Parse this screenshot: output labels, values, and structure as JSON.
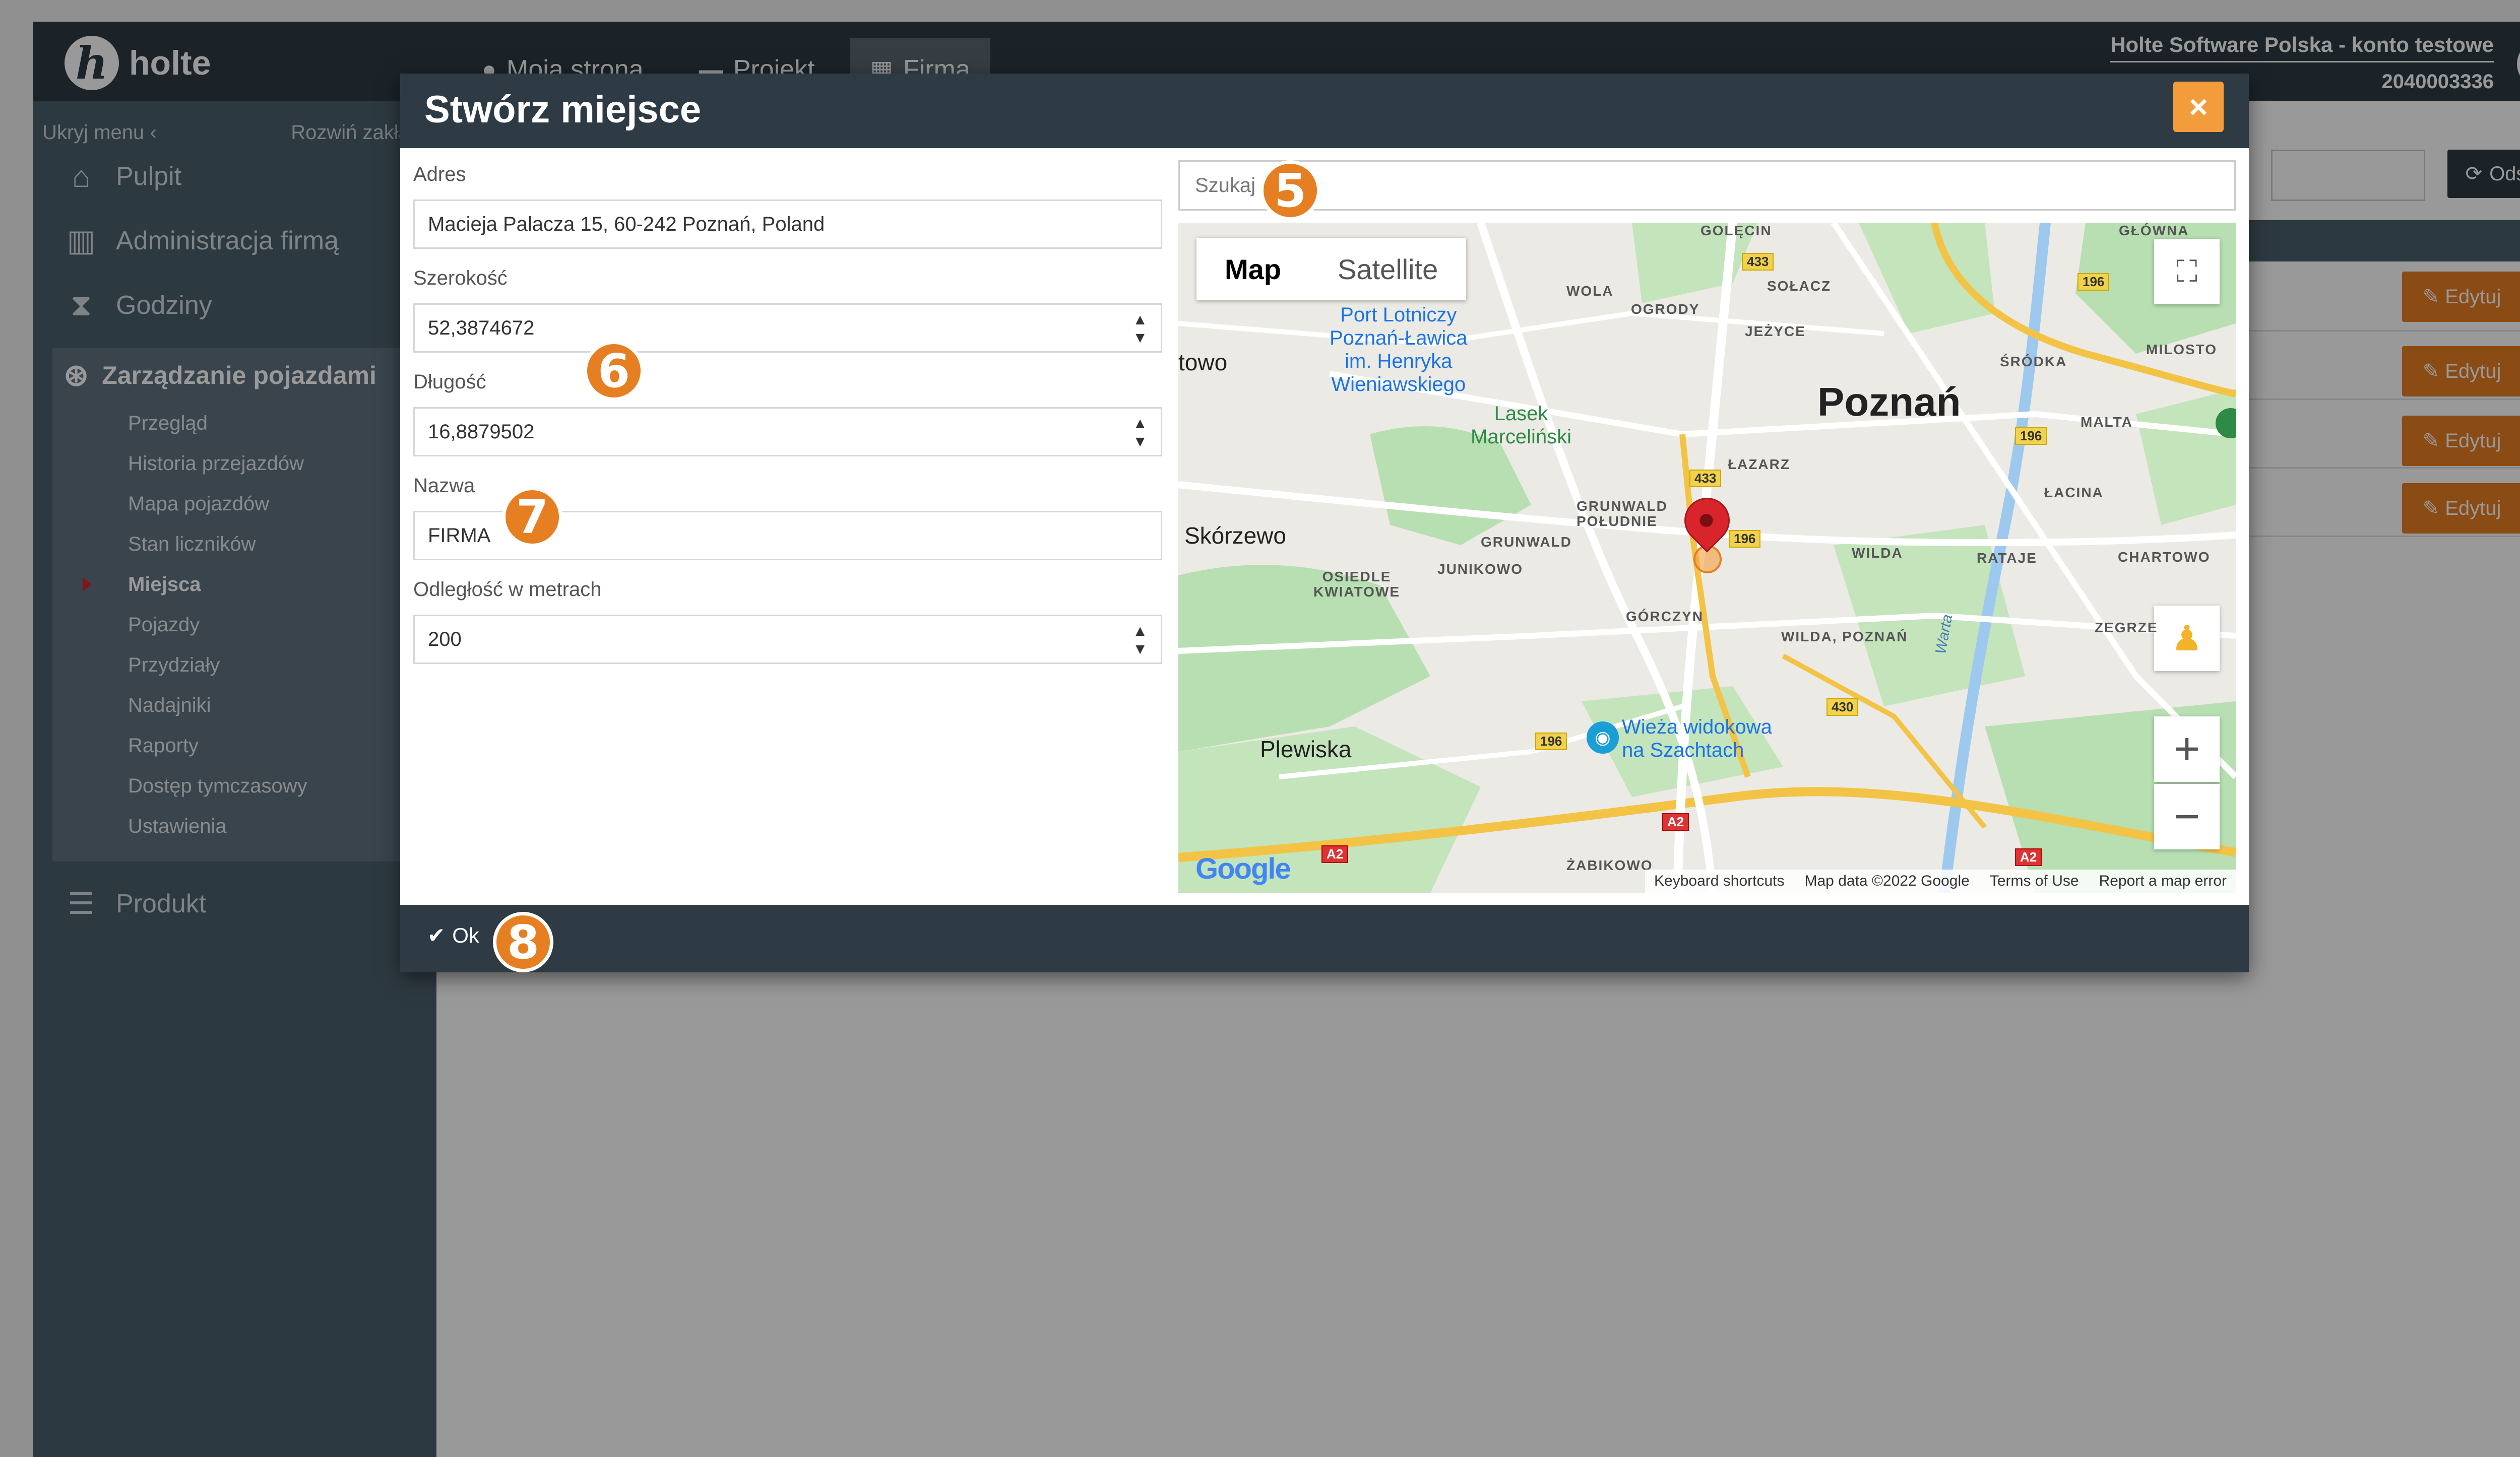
{
  "app": {
    "logo_letter": "h",
    "logo_text": "holte",
    "nav": [
      {
        "label": "Moja strona",
        "icon": "user-dot-icon"
      },
      {
        "label": "Projekt",
        "icon": "folder-icon"
      },
      {
        "label": "Firma",
        "icon": "building-icon"
      }
    ],
    "company_name": "Holte Software Polska - konto testowe",
    "company_number": "2040003336"
  },
  "sidebar": {
    "hide_menu": "Ukryj menu",
    "expand_tabs": "Rozwiń zakładki",
    "items": [
      {
        "label": "Pulpit",
        "icon": "home-icon"
      },
      {
        "label": "Administracja firmą",
        "icon": "building-icon"
      },
      {
        "label": "Godziny",
        "icon": "hourglass-icon"
      }
    ],
    "group": {
      "title": "Zarządzanie pojazdami",
      "icon": "steering-wheel-icon",
      "subitems": [
        "Przegląd",
        "Historia przejazdów",
        "Mapa pojazdów",
        "Stan liczników",
        "Miejsca",
        "Pojazdy",
        "Przydziały",
        "Nadajniki",
        "Raporty",
        "Dostęp tymczasowy",
        "Ustawienia"
      ],
      "active": "Miejsca"
    },
    "product": {
      "label": "Produkt",
      "icon": "list-icon"
    }
  },
  "main": {
    "refresh_label": "Odśwież",
    "edit_label": "Edytuj"
  },
  "modal": {
    "title": "Stwórz miejsce",
    "close": "×",
    "fields": {
      "address_label": "Adres",
      "address_value": "Macieja Palacza 15, 60-242 Poznań, Poland",
      "lat_label": "Szerokość",
      "lat_value": "52,3874672",
      "lng_label": "Długość",
      "lng_value": "16,8879502",
      "name_label": "Nazwa",
      "name_value": "FIRMA",
      "distance_label": "Odległość w metrach",
      "distance_value": "200"
    },
    "search_placeholder": "Szukaj",
    "ok_label": "Ok"
  },
  "map": {
    "type_map": "Map",
    "type_satellite": "Satellite",
    "labels": {
      "poznan": "Poznań",
      "airport": "Port Lotniczy\nPoznań-Ławica\nim. Henryka\nWieniawskiego",
      "lasek": "Lasek\nMarceliński",
      "skorzewo": "Skórzewo",
      "plewiska": "Plewiska",
      "tower": "Wieża widokowa\nna Szachtach",
      "towo": "towo",
      "wola": "WOLA",
      "ogrody": "OGRODY",
      "solacz": "SOŁACZ",
      "jezyce": "JEŻYCE",
      "srodka": "ŚRÓDKA",
      "milosto": "MILOSTO",
      "malta": "MALTA",
      "lazarz": "ŁAZARZ",
      "lacina": "ŁACINA",
      "grunwald_pol": "GRUNWALD\nPOŁUDNIE",
      "grunwald": "GRUNWALD",
      "junikowo": "JUNIKOWO",
      "osiedle": "OSIEDLE\nKWIATOWE",
      "wilda": "WILDA",
      "rataje": "RATAJE",
      "chartowo": "CHARTOWO",
      "gorczyn": "GÓRCZYN",
      "wilda_poznan": "WILDA, POZNAŃ",
      "zegrze": "ZEGRZE",
      "zabikowo": "ŻABIKOWO",
      "golecin": "GOLĘCIN",
      "glowna": "GŁÓWNA",
      "warta": "Warta"
    },
    "roads": [
      "433",
      "196",
      "196",
      "433",
      "196",
      "196",
      "430",
      "A2",
      "A2",
      "A2"
    ],
    "google": "Google",
    "attribution": [
      "Keyboard shortcuts",
      "Map data ©2022 Google",
      "Terms of Use",
      "Report a map error"
    ]
  },
  "badges": [
    "5",
    "6",
    "7",
    "8"
  ],
  "colors": {
    "header": "#2e3b45",
    "accent": "#e67e22",
    "sidebar": "#4b5f6d",
    "marker": "#d9242c"
  }
}
